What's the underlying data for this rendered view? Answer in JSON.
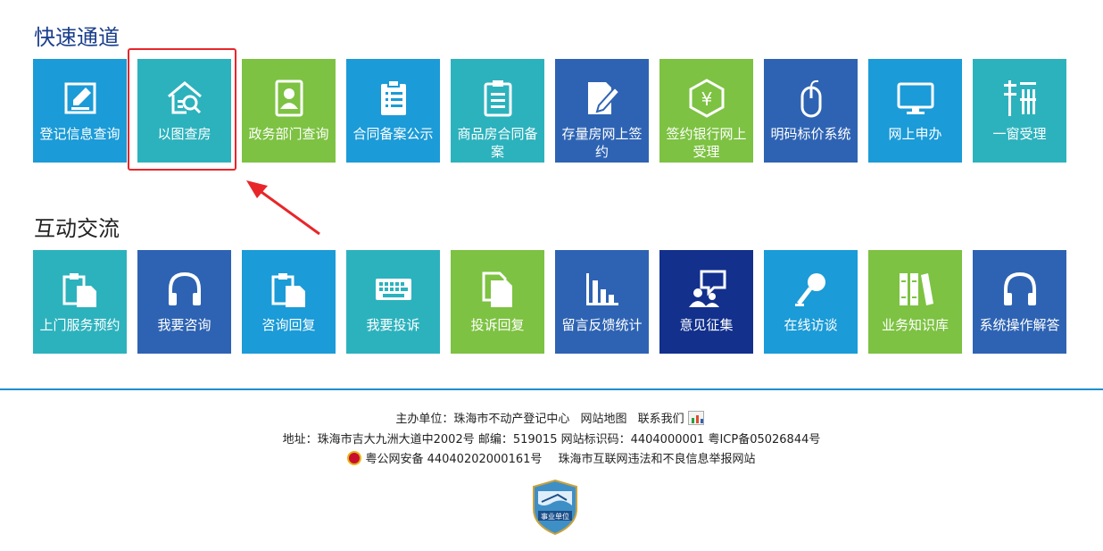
{
  "quick_access": {
    "title": "快速通道",
    "tiles": [
      {
        "label": "登记信息查询",
        "color": "#1b9bd7",
        "icon": "edit-form-icon"
      },
      {
        "label": "以图查房",
        "color": "#2cb2bd",
        "icon": "house-search-icon"
      },
      {
        "label": "政务部门查询",
        "color": "#7dc242",
        "icon": "id-card-icon"
      },
      {
        "label": "合同备案公示",
        "color": "#1b9bd7",
        "icon": "clipboard-list-icon"
      },
      {
        "label": "商品房合同备案",
        "color": "#2cb2bd",
        "icon": "clipboard-doc-icon"
      },
      {
        "label": "存量房网上签约",
        "color": "#2e63b3",
        "icon": "sign-pen-icon"
      },
      {
        "label": "签约银行网上受理",
        "color": "#7dc242",
        "icon": "bank-yen-icon"
      },
      {
        "label": "明码标价系统",
        "color": "#2e63b3",
        "icon": "mouse-icon"
      },
      {
        "label": "网上申办",
        "color": "#1b9bd7",
        "icon": "monitor-icon"
      },
      {
        "label": "一窗受理",
        "color": "#2cb2bd",
        "icon": "tax-window-icon"
      }
    ]
  },
  "interaction": {
    "title": "互动交流",
    "tiles": [
      {
        "label": "上门服务预约",
        "color": "#2cb2bd",
        "icon": "clipboard-copy-icon"
      },
      {
        "label": "我要咨询",
        "color": "#2e63b3",
        "icon": "headphones-icon"
      },
      {
        "label": "咨询回复",
        "color": "#1b9bd7",
        "icon": "clipboard-copy-icon"
      },
      {
        "label": "我要投诉",
        "color": "#2cb2bd",
        "icon": "keyboard-icon"
      },
      {
        "label": "投诉回复",
        "color": "#7dc242",
        "icon": "documents-icon"
      },
      {
        "label": "留言反馈统计",
        "color": "#2e63b3",
        "icon": "bar-chart-icon"
      },
      {
        "label": "意见征集",
        "color": "#12308c",
        "icon": "people-chat-icon"
      },
      {
        "label": "在线访谈",
        "color": "#1b9bd7",
        "icon": "microphone-icon"
      },
      {
        "label": "业务知识库",
        "color": "#7dc242",
        "icon": "books-icon"
      },
      {
        "label": "系统操作解答",
        "color": "#2e63b3",
        "icon": "headphones-icon"
      }
    ]
  },
  "footer": {
    "host_label": "主办单位：珠海市不动产登记中心",
    "sitemap": "网站地图",
    "contact": "联系我们",
    "address": "地址：珠海市吉大九洲大道中2002号 邮编：519015 网站标识码：4404000001 粤ICP备05026844号",
    "police_reg": "粤公网安备 44040202000161号",
    "report_site": "珠海市互联网违法和不良信息举报网站",
    "stat_badge": "CNZZ",
    "shield_text": "事业单位"
  },
  "accent_colors": {
    "highlight": "#e8262a",
    "divider": "#1c8fd0"
  }
}
